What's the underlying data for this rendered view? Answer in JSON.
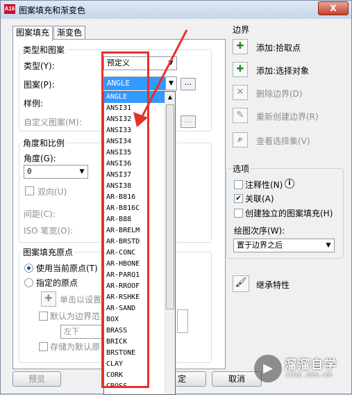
{
  "window": {
    "title": "图案填充和渐变色",
    "app_icon_text": "A16",
    "close_glyph": "X"
  },
  "tabs": [
    {
      "label": "图案填充"
    },
    {
      "label": "渐变色"
    }
  ],
  "type_pattern": {
    "group_label": "类型和图案",
    "type_label": "类型(Y):",
    "type_value": "预定义",
    "pattern_label": "图案(P):",
    "pattern_value": "ANGLE",
    "swatch_label": "样例:",
    "custom_label": "自定义图案(M):",
    "dots": "..."
  },
  "angle_scale": {
    "group_label": "角度和比例",
    "angle_label": "角度(G):",
    "angle_value": "0",
    "double_label": "双向(U)",
    "spacing_label": "间距(C):",
    "iso_label": "ISO 笔宽(O):"
  },
  "origin": {
    "group_label": "图案填充原点",
    "use_current_label": "使用当前原点(T)",
    "specified_label": "指定的原点",
    "click_set_label": "单击以设置",
    "default_boundary_label": "默认为边界范",
    "position_value": "左下",
    "store_default_label": "存储为默认原"
  },
  "pattern_list": {
    "items": [
      "ANGLE",
      "ANSI31",
      "ANSI32",
      "ANSI33",
      "ANSI34",
      "ANSI35",
      "ANSI36",
      "ANSI37",
      "ANSI38",
      "AR-B816",
      "AR-B816C",
      "AR-B88",
      "AR-BRELM",
      "AR-BRSTD",
      "AR-CONC",
      "AR-HBONE",
      "AR-PARQ1",
      "AR-RROOF",
      "AR-RSHKE",
      "AR-SAND",
      "BOX",
      "BRASS",
      "BRICK",
      "BRSTONE",
      "CLAY",
      "CORK",
      "CROSS"
    ],
    "selected_index": 0
  },
  "boundaries": {
    "group_label": "边界",
    "add_pick_label": "添加:拾取点",
    "add_select_label": "添加:选择对象",
    "remove_label": "删除边界(D)",
    "recreate_label": "重新创建边界(R)",
    "view_label": "查看选择集(V)"
  },
  "options": {
    "group_label": "选项",
    "annotative_label": "注释性(N)",
    "associative_label": "关联(A)",
    "separate_label": "创建独立的图案填充(H)",
    "draw_order_label": "绘图次序(W):",
    "draw_order_value": "置于边界之后",
    "info_glyph": "i"
  },
  "inherit": {
    "label": "继承特性"
  },
  "buttons": {
    "preview": "预览",
    "ok_partial": "定",
    "cancel": "取消"
  },
  "watermark": {
    "text": "溜溜自学",
    "sub": "ZIXUE.3D66.COM"
  }
}
